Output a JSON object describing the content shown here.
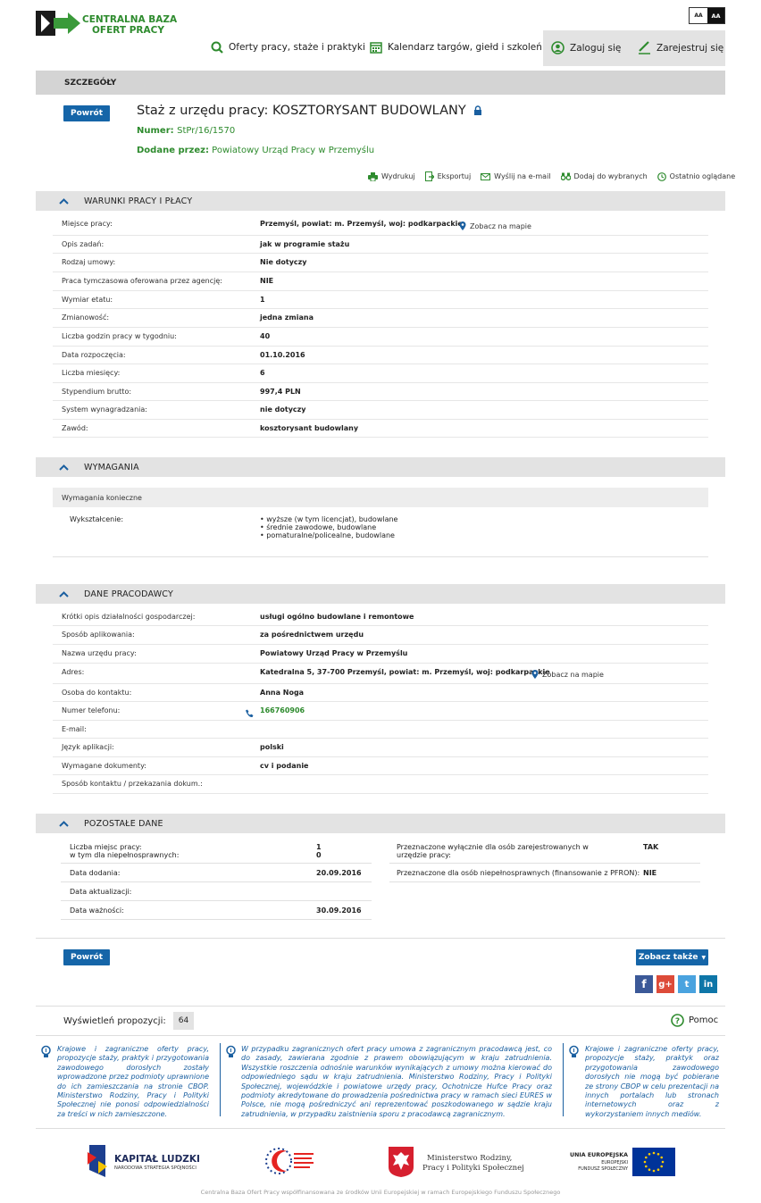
{
  "logo": {
    "line1": "CENTRALNA BAZA",
    "line2": "OFERT PRACY"
  },
  "font_toggle": {
    "small": "AA",
    "large": "AA"
  },
  "nav": {
    "offers": "Oferty pracy, staże i praktyki",
    "calendar": "Kalendarz targów, giełd i szkoleń",
    "login": "Zaloguj się",
    "register": "Zarejestruj się"
  },
  "details_bar": "SZCZEGÓŁY",
  "back_label": "Powrót",
  "offer": {
    "title": "Staż z urzędu pracy: KOSZTORYSANT BUDOWLANY",
    "number_label": "Numer:",
    "number": "StPr/16/1570",
    "added_by_label": "Dodane przez:",
    "added_by": "Powiatowy Urząd Pracy w Przemyślu"
  },
  "tools": {
    "print": "Wydrukuj",
    "export": "Eksportuj",
    "email": "Wyślij na e-mail",
    "add": "Dodaj do wybranych",
    "recent": "Ostatnio oglądane"
  },
  "map_link": "Zobacz na mapie",
  "sections": {
    "conditions": "WARUNKI PRACY I PŁACY",
    "requirements": "WYMAGANIA",
    "employer": "DANE PRACODAWCY",
    "other": "POZOSTAŁE DANE"
  },
  "conditions": [
    {
      "k": "Miejsce pracy:",
      "v": "Przemyśl, powiat: m. Przemyśl, woj: podkarpackie"
    },
    {
      "k": "Opis zadań:",
      "v": "jak w programie stażu"
    },
    {
      "k": "Rodzaj umowy:",
      "v": "Nie dotyczy"
    },
    {
      "k": "Praca tymczasowa oferowana przez agencję:",
      "v": "NIE"
    },
    {
      "k": "Wymiar etatu:",
      "v": "1"
    },
    {
      "k": "Zmianowość:",
      "v": "jedna zmiana"
    },
    {
      "k": "Liczba godzin pracy w tygodniu:",
      "v": "40"
    },
    {
      "k": "Data rozpoczęcia:",
      "v": "01.10.2016"
    },
    {
      "k": "Liczba miesięcy:",
      "v": "6"
    },
    {
      "k": "Stypendium brutto:",
      "v": "997,4 PLN"
    },
    {
      "k": "System wynagradzania:",
      "v": "nie dotyczy"
    },
    {
      "k": "Zawód:",
      "v": "kosztorysant budowlany"
    }
  ],
  "requirements": {
    "subheader": "Wymagania konieczne",
    "education_label": "Wykształcenie:",
    "education": [
      "wyższe (w tym licencjat), budowlane",
      "średnie zawodowe, budowlane",
      "pomaturalne/policealne, budowlane"
    ]
  },
  "employer": [
    {
      "k": "Krótki opis działalności gospodarczej:",
      "v": "usługi ogólno budowlane i remontowe"
    },
    {
      "k": "Sposób aplikowania:",
      "v": "za pośrednictwem urzędu"
    },
    {
      "k": "Nazwa urzędu pracy:",
      "v": "Powiatowy Urząd Pracy w Przemyślu"
    },
    {
      "k": "Adres:",
      "v": "Katedralna 5, 37-700 Przemyśl, powiat: m. Przemyśl, woj: podkarpackie"
    },
    {
      "k": "Osoba do kontaktu:",
      "v": "Anna Noga"
    },
    {
      "k": "Numer telefonu:",
      "v": "166760906"
    },
    {
      "k": "E-mail:",
      "v": ""
    },
    {
      "k": "Język aplikacji:",
      "v": "polski"
    },
    {
      "k": "Wymagane dokumenty:",
      "v": "cv i podanie"
    },
    {
      "k": "Sposób kontaktu / przekazania dokum.:",
      "v": ""
    }
  ],
  "other": {
    "places_label": "Liczba miejsc pracy:",
    "places_value": "1",
    "disabled_label": "w tym dla niepełnosprawnych:",
    "disabled_value": "0",
    "added_label": "Data dodania:",
    "added_value": "20.09.2016",
    "updated_label": "Data aktualizacji:",
    "updated_value": "",
    "valid_label": "Data ważności:",
    "valid_value": "30.09.2016",
    "registered_label": "Przeznaczone wyłącznie dla osób zarejestrowanych w urzędzie pracy:",
    "registered_value": "TAK",
    "pfron_label": "Przeznaczone dla osób niepełnosprawnych (finansowanie z PFRON):",
    "pfron_value": "NIE"
  },
  "see_also": "Zobacz także",
  "views_label": "Wyświetleń propozycji:",
  "views_count": "64",
  "help": "Pomoc",
  "notes": [
    "Krajowe i zagraniczne oferty pracy, propozycje staży, praktyk i przygotowania zawodowego dorosłych zostały wprowadzone przez podmioty uprawnione do ich zamieszczania na stronie CBOP. Ministerstwo Rodziny, Pracy i Polityki Społecznej nie ponosi odpowiedzialności za treści w nich zamieszczone.",
    "W przypadku zagranicznych ofert pracy umowa z zagranicznym pracodawcą jest, co do zasady, zawierana zgodnie z prawem obowiązującym w kraju zatrudnienia. Wszystkie roszczenia odnośnie warunków wynikających z umowy można kierować do odpowiedniego sądu w kraju zatrudnienia. Ministerstwo Rodziny, Pracy i Polityki Społecznej, wojewódzkie i powiatowe urzędy pracy, Ochotnicze Hufce Pracy oraz podmioty akredytowane do prowadzenia pośrednictwa pracy w ramach sieci EURES w Polsce, nie mogą pośredniczyć ani reprezentować poszkodowanego w sądzie kraju zatrudnienia, w przypadku zaistnienia sporu z pracodawcą zagranicznym.",
    "Krajowe i zagraniczne oferty pracy, propozycje staży, praktyk oraz przygotowania zawodowego dorosłych nie mogą być pobierane ze strony CBOP w celu prezentacji na innych portalach lub stronach internetowych oraz z wykorzystaniem innych mediów."
  ],
  "sponsors": {
    "kl_title": "KAPITAŁ LUDZKI",
    "kl_sub": "NARODOWA STRATEGIA SPÓJNOŚCI",
    "ministry_line1": "Ministerstwo Rodziny,",
    "ministry_line2": "Pracy i Polityki Społecznej",
    "eu_line1": "UNIA EUROPEJSKA",
    "eu_line2": "EUROPEJSKI",
    "eu_line3": "FUNDUSZ SPOŁECZNY"
  },
  "footer": "Centralna Baza Ofert Pracy współfinansowana ze środków Unii Europejskiej w ramach Europejskiego Funduszu Społecznego"
}
